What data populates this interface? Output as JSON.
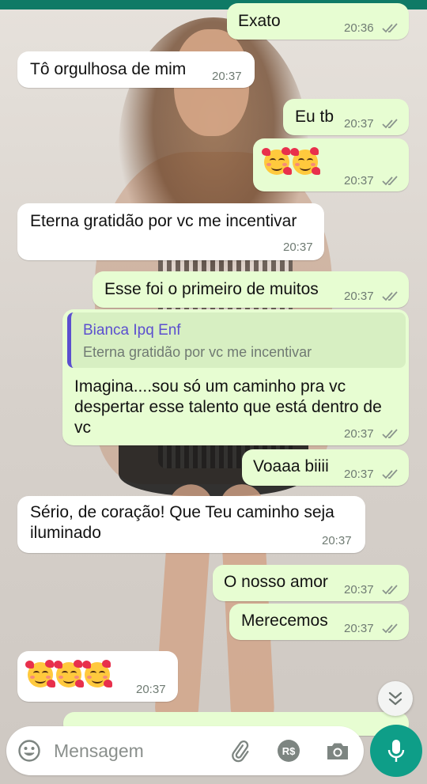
{
  "messages": [
    {
      "dir": "out",
      "text": "Exato",
      "time": "20:36"
    },
    {
      "dir": "in",
      "text": "Tô orgulhosa de mim",
      "time": "20:37"
    },
    {
      "dir": "out",
      "text": "Eu tb",
      "time": "20:37"
    },
    {
      "dir": "out",
      "emoji": "smiling-face-with-hearts",
      "time": "20:37"
    },
    {
      "dir": "in",
      "text": "Eterna gratidão por vc me incentivar",
      "time": "20:37"
    },
    {
      "dir": "out",
      "text": "Esse foi o primeiro de muitos",
      "time": "20:37"
    },
    {
      "dir": "out",
      "text": "Imagina....sou só um caminho pra vc despertar esse talento que está dentro de vc",
      "time": "20:37",
      "quoted": {
        "name": "Bianca Ipq Enf",
        "text": "Eterna gratidão por vc me incentivar"
      }
    },
    {
      "dir": "out",
      "text": "Voaaa biiii",
      "time": "20:37"
    },
    {
      "dir": "in",
      "text": "Sério, de coração! Que Teu caminho seja iluminado",
      "time": "20:37"
    },
    {
      "dir": "out",
      "text": "O nosso amor",
      "time": "20:37"
    },
    {
      "dir": "out",
      "text": "Merecemos",
      "time": "20:37"
    },
    {
      "dir": "in",
      "emoji": "smiling-face-with-hearts",
      "time": "20:37"
    }
  ],
  "composer": {
    "placeholder": "Mensagem"
  },
  "icons": {
    "emoji": "smiley-icon",
    "attach": "paperclip-icon",
    "payment": "real-currency-icon",
    "camera": "camera-icon",
    "mic": "microphone-icon",
    "scroll": "double-chevron-down-icon"
  },
  "colors": {
    "outgoing": "#e7fdd2",
    "incoming": "#ffffff",
    "accent": "#0e9e88",
    "quote_bar": "#5b4fcf",
    "read_ticks": "#8a948d"
  }
}
